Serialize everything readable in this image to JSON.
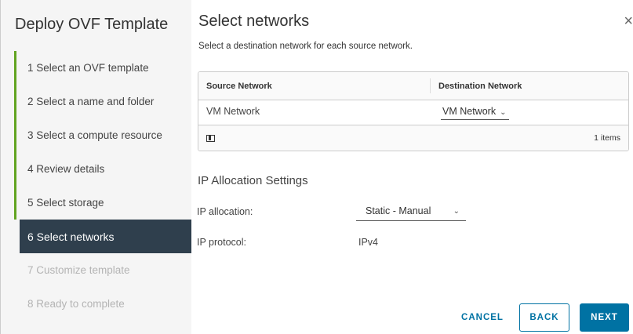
{
  "wizard": {
    "title": "Deploy OVF Template",
    "steps": [
      {
        "label": "1  Select an OVF template",
        "state": "done"
      },
      {
        "label": "2  Select a name and folder",
        "state": "done"
      },
      {
        "label": "3  Select a compute resource",
        "state": "done"
      },
      {
        "label": "4  Review details",
        "state": "done"
      },
      {
        "label": "5  Select storage",
        "state": "done"
      },
      {
        "label": "6  Select networks",
        "state": "active"
      },
      {
        "label": "7  Customize template",
        "state": "future"
      },
      {
        "label": "8  Ready to complete",
        "state": "future"
      }
    ]
  },
  "page": {
    "title": "Select networks",
    "subtitle": "Select a destination network for each source network.",
    "close_icon": "×"
  },
  "grid": {
    "columns": [
      "Source Network",
      "Destination Network"
    ],
    "rows": [
      {
        "source": "VM Network",
        "destination": "VM Network"
      }
    ],
    "footer_count": "1 items"
  },
  "ip_settings": {
    "title": "IP Allocation Settings",
    "allocation_label": "IP allocation:",
    "allocation_value": "Static - Manual",
    "protocol_label": "IP protocol:",
    "protocol_value": "IPv4"
  },
  "buttons": {
    "cancel": "CANCEL",
    "back": "BACK",
    "next": "NEXT"
  },
  "colors": {
    "accent": "#0072a3",
    "active_step_bg": "#2f3f4d",
    "done_bar": "#62a420"
  },
  "icons": {
    "close": "close-icon",
    "caret": "chevron-down-icon",
    "column_toggle": "column-toggle-icon"
  }
}
